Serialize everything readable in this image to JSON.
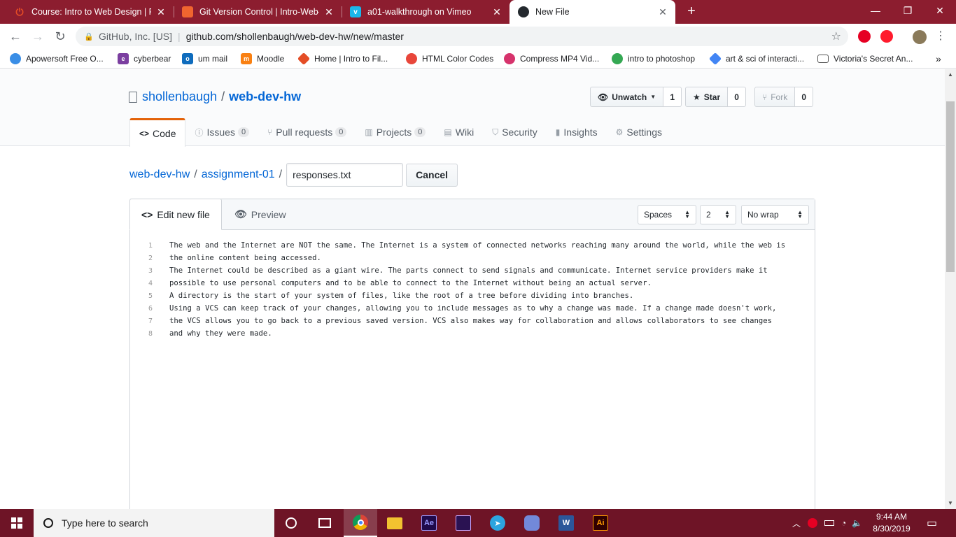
{
  "browser": {
    "tabs": [
      {
        "title": "Course: Intro to Web Design | Fal",
        "icon": "power-icon",
        "color": "#e34c26"
      },
      {
        "title": "Git Version Control | Intro-Web-D",
        "icon": "shield-icon",
        "color": "#f0652f"
      },
      {
        "title": "a01-walkthrough on Vimeo",
        "icon": "vimeo-icon",
        "color": "#1ab7ea"
      },
      {
        "title": "New File",
        "icon": "github-icon",
        "color": "#24292e"
      }
    ],
    "window_controls": {
      "minimize": "—",
      "restore": "❐",
      "close": "✕"
    },
    "address": {
      "org": "GitHub, Inc. [US]",
      "url": "github.com/shollenbaugh/web-dev-hw/new/master"
    },
    "bookmarks": [
      {
        "label": "Apowersoft Free O...",
        "color": "#3a8ee6"
      },
      {
        "label": "cyberbear",
        "color": "#7b3fa0"
      },
      {
        "label": "um mail",
        "color": "#0f6cbd"
      },
      {
        "label": "Moodle",
        "color": "#f98012"
      },
      {
        "label": "Home | Intro to Fil...",
        "color": "#e44d26"
      },
      {
        "label": "HTML Color Codes",
        "color": "#e8463a"
      },
      {
        "label": "Compress MP4 Vid...",
        "color": "#d6336c"
      },
      {
        "label": "intro to photoshop",
        "color": "#34a853"
      },
      {
        "label": "art & sci of interacti...",
        "color": "#4285f4"
      },
      {
        "label": "Victoria's Secret An...",
        "color": "#555555"
      }
    ],
    "bookmarks_more": "»"
  },
  "repo": {
    "owner": "shollenbaugh",
    "name": "web-dev-hw",
    "unwatch_label": "Unwatch",
    "watch_count": "1",
    "star_label": "Star",
    "star_count": "0",
    "fork_label": "Fork",
    "fork_count": "0"
  },
  "nav": [
    {
      "label": "Code",
      "icon": "code-icon",
      "glyph": "<>"
    },
    {
      "label": "Issues",
      "count": "0",
      "icon": "issue-icon",
      "glyph": "ⓘ"
    },
    {
      "label": "Pull requests",
      "count": "0",
      "icon": "pull-request-icon",
      "glyph": "⑂"
    },
    {
      "label": "Projects",
      "count": "0",
      "icon": "project-icon",
      "glyph": "▥"
    },
    {
      "label": "Wiki",
      "icon": "book-icon",
      "glyph": "▤"
    },
    {
      "label": "Security",
      "icon": "shield-icon",
      "glyph": "⛉"
    },
    {
      "label": "Insights",
      "icon": "graph-icon",
      "glyph": "▮"
    },
    {
      "label": "Settings",
      "icon": "gear-icon",
      "glyph": "⚙"
    }
  ],
  "breadcrumb": {
    "repo": "web-dev-hw",
    "folder": "assignment-01",
    "filename": "responses.txt",
    "cancel_label": "Cancel"
  },
  "editor": {
    "edit_tab": "Edit new file",
    "preview_tab": "Preview",
    "indent_mode": "Spaces",
    "indent_size": "2",
    "wrap_mode": "No wrap",
    "lines": [
      "The web and the Internet are NOT the same. The Internet is a system of connected networks reaching many around the world, while the web is",
      "the online content being accessed.",
      "The Internet could be described as a giant wire. The parts connect to send signals and communicate. Internet service providers make it",
      "possible to use personal computers and to be able to connect to the Internet without being an actual server.",
      "A directory is the start of your system of files, like the root of a tree before dividing into branches.",
      "Using a VCS can keep track of your changes, allowing you to include messages as to why a change was made. If a change made doesn't work,",
      "the VCS allows you to go back to a previous saved version. VCS also makes way for collaboration and allows collaborators to see changes",
      "and why they were made."
    ]
  },
  "taskbar": {
    "search_placeholder": "Type here to search",
    "time": "9:44 AM",
    "date": "8/30/2019",
    "apps": [
      {
        "name": "cortana-icon",
        "label": "",
        "color": "transparent"
      },
      {
        "name": "task-view-icon",
        "label": "",
        "color": "transparent"
      },
      {
        "name": "chrome-icon",
        "label": "",
        "color": "#4285f4"
      },
      {
        "name": "file-explorer-icon",
        "label": "",
        "color": "#f2c230"
      },
      {
        "name": "after-effects-icon",
        "label": "Ae",
        "color": "#1f0a4a"
      },
      {
        "name": "premiere-icon",
        "label": "",
        "color": "#2a1252"
      },
      {
        "name": "telegram-icon",
        "label": "",
        "color": "#2ca5e0"
      },
      {
        "name": "discord-icon",
        "label": "",
        "color": "#7289da"
      },
      {
        "name": "word-icon",
        "label": "W",
        "color": "#2b579a"
      },
      {
        "name": "illustrator-icon",
        "label": "Ai",
        "color": "#310000"
      }
    ]
  }
}
